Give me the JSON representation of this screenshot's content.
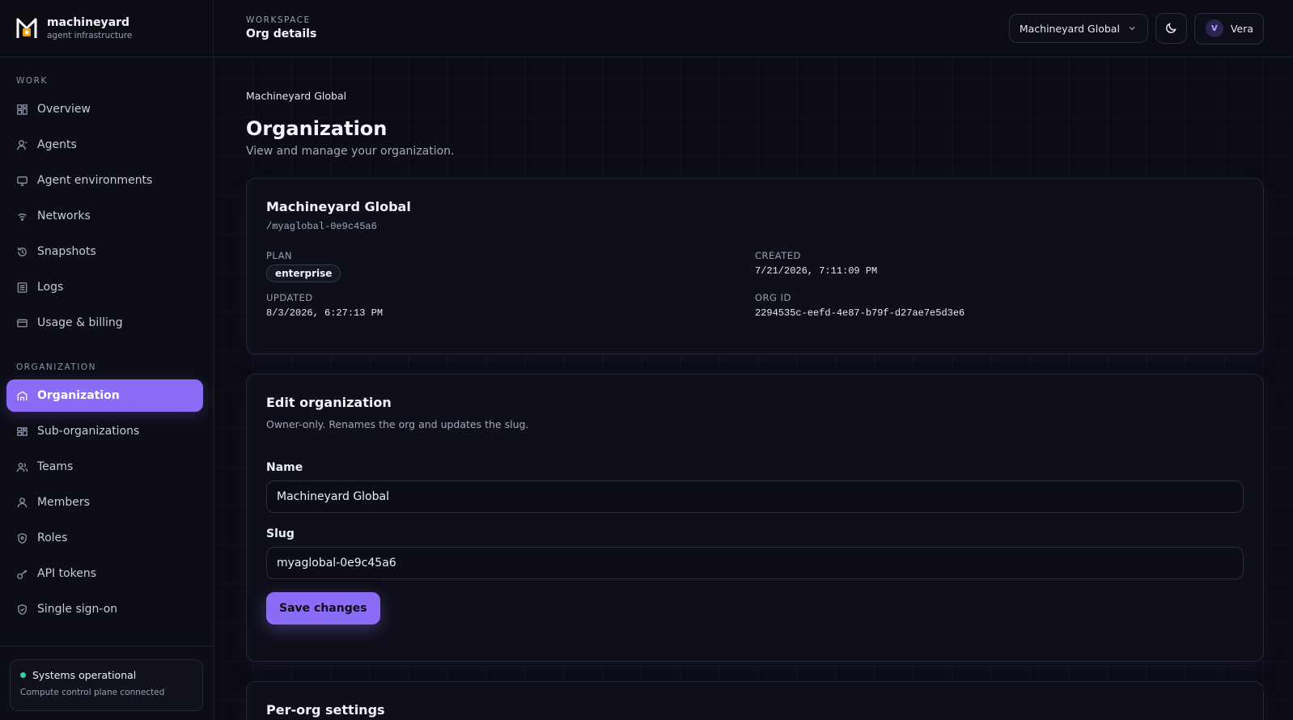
{
  "brand": {
    "name": "machineyard",
    "subtitle": "agent infrastructure"
  },
  "nav": {
    "work_label": "WORK",
    "work_items": [
      {
        "label": "Overview",
        "icon": "grid-icon"
      },
      {
        "label": "Agents",
        "icon": "user-icon"
      },
      {
        "label": "Agent environments",
        "icon": "monitor-icon"
      },
      {
        "label": "Networks",
        "icon": "signal-icon"
      },
      {
        "label": "Snapshots",
        "icon": "history-icon"
      },
      {
        "label": "Logs",
        "icon": "list-icon"
      },
      {
        "label": "Usage & billing",
        "icon": "card-icon"
      }
    ],
    "org_label": "ORGANIZATION",
    "org_items": [
      {
        "label": "Organization",
        "icon": "building-icon",
        "active": true
      },
      {
        "label": "Sub-organizations",
        "icon": "sub-org-icon"
      },
      {
        "label": "Teams",
        "icon": "users-icon"
      },
      {
        "label": "Members",
        "icon": "person-icon"
      },
      {
        "label": "Roles",
        "icon": "shield-icon"
      },
      {
        "label": "API tokens",
        "icon": "key-icon"
      },
      {
        "label": "Single sign-on",
        "icon": "shield-check-icon"
      }
    ]
  },
  "status": {
    "title": "Systems operational",
    "subtitle": "Compute control plane connected",
    "color": "#34d399"
  },
  "topbar": {
    "label": "WORKSPACE",
    "title": "Org details",
    "org_selector": "Machineyard Global",
    "user_initial": "V",
    "user_name": "Vera"
  },
  "page": {
    "breadcrumb": "Machineyard Global",
    "title": "Organization",
    "subtitle": "View and manage your organization."
  },
  "details": {
    "name": "Machineyard Global",
    "slug": "/myaglobal-0e9c45a6",
    "plan_label": "PLAN",
    "plan": "enterprise",
    "created_label": "CREATED",
    "created": "7/21/2026, 7:11:09 PM",
    "updated_label": "UPDATED",
    "updated": "8/3/2026, 6:27:13 PM",
    "org_id_label": "ORG ID",
    "org_id": "2294535c-eefd-4e87-b79f-d27ae7e5d3e6"
  },
  "edit": {
    "title": "Edit organization",
    "description": "Owner-only. Renames the org and updates the slug.",
    "name_label": "Name",
    "name_value": "Machineyard Global",
    "slug_label": "Slug",
    "slug_value": "myaglobal-0e9c45a6",
    "save_label": "Save changes"
  },
  "settings": {
    "title": "Per-org settings"
  },
  "colors": {
    "accent": "#8b6cf6",
    "background": "#0b0c14"
  }
}
